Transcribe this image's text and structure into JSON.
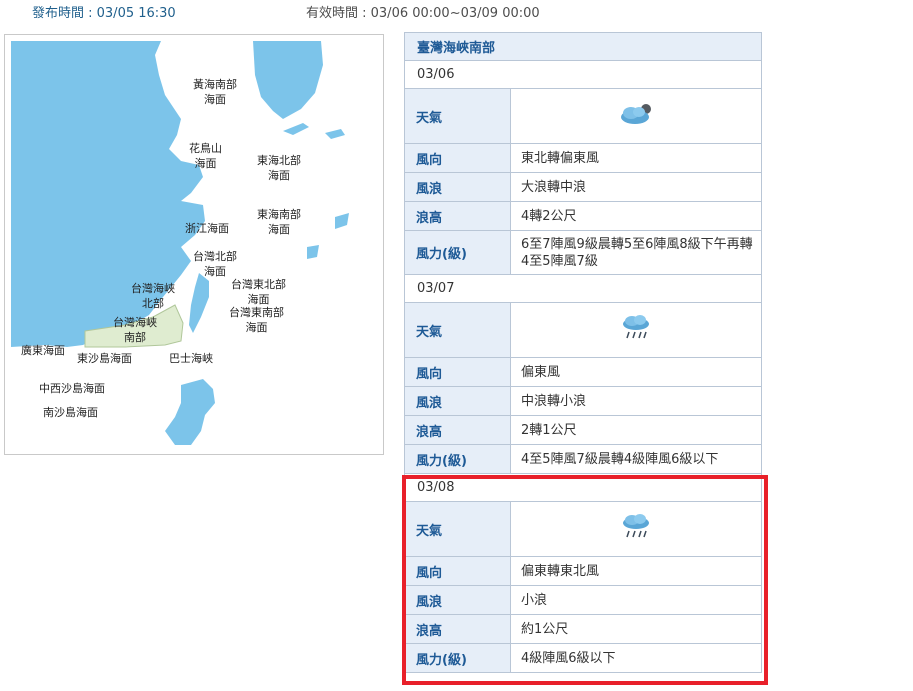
{
  "header": {
    "issued": "發布時間 : 03/05 16:30",
    "valid": "有效時間 : 03/06 00:00~03/09 00:00"
  },
  "map": {
    "labels": [
      "黃海南部\n海面",
      "花鳥山\n海面",
      "東海北部\n海面",
      "東海南部\n海面",
      "浙江海面",
      "台灣北部\n海面",
      "台灣海峽\n北部",
      "台灣東北部\n海面",
      "台灣海峽\n南部",
      "台灣東南部\n海面",
      "廣東海面",
      "東沙島海面",
      "巴士海峽",
      "中西沙島海面",
      "南沙島海面"
    ]
  },
  "forecast": {
    "title": "臺灣海峽南部",
    "days": [
      {
        "date": "03/06",
        "weather_label": "天氣",
        "weather_icon": "cloudy-icon",
        "wind_dir_label": "風向",
        "wind_dir": "東北轉偏東風",
        "wave_label": "風浪",
        "wave": "大浪轉中浪",
        "height_label": "浪高",
        "height": "4轉2公尺",
        "force_label": "風力(級)",
        "force": "6至7陣風9級晨轉5至6陣風8級下午再轉4至5陣風7級"
      },
      {
        "date": "03/07",
        "weather_label": "天氣",
        "weather_icon": "rain-icon",
        "wind_dir_label": "風向",
        "wind_dir": "偏東風",
        "wave_label": "風浪",
        "wave": "中浪轉小浪",
        "height_label": "浪高",
        "height": "2轉1公尺",
        "force_label": "風力(級)",
        "force": "4至5陣風7級晨轉4級陣風6級以下"
      },
      {
        "date": "03/08",
        "weather_label": "天氣",
        "weather_icon": "rain-icon",
        "wind_dir_label": "風向",
        "wind_dir": "偏東轉東北風",
        "wave_label": "風浪",
        "wave": "小浪",
        "height_label": "浪高",
        "height": "約1公尺",
        "force_label": "風力(級)",
        "force": "4級陣風6級以下"
      }
    ]
  },
  "colors": {
    "sea": "#7cc4ea",
    "land": "#ffffff",
    "highlight_region": "#dfecd0",
    "label_bg": "#e6eef8",
    "label_text": "#1e5a96",
    "border": "#b9c6d6",
    "highlight_border": "#e8202a"
  }
}
